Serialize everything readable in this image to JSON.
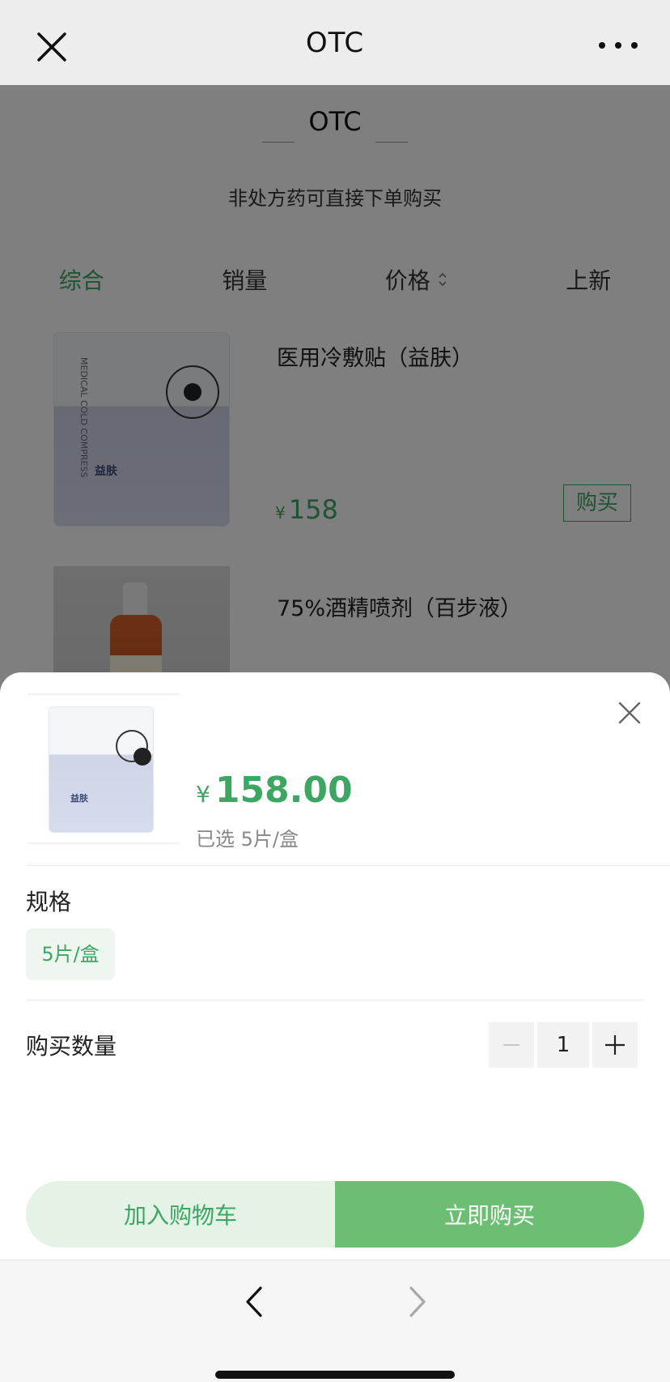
{
  "navbar": {
    "title": "OTC",
    "close_icon": "close-icon",
    "more_icon": "more-icon"
  },
  "section": {
    "title": "OTC",
    "subtitle": "非处方药可直接下单购买"
  },
  "sort": {
    "items": [
      {
        "label": "综合",
        "active": true
      },
      {
        "label": "销量"
      },
      {
        "label": "价格",
        "icon": "sort-arrows-icon"
      },
      {
        "label": "上新"
      }
    ]
  },
  "products": [
    {
      "name": "医用冷敷贴（益肤）",
      "currency": "¥",
      "price": "158",
      "buy_label": "购买",
      "thumb_brand": "益肤"
    },
    {
      "name": "75%酒精喷剂（百步液）"
    }
  ],
  "sheet": {
    "currency": "¥",
    "price": "158.00",
    "selected": "已选 5片/盒",
    "spec_label": "规格",
    "spec_option": "5片/盒",
    "qty_label": "购买数量",
    "qty_value": "1",
    "add_cart_label": "加入购物车",
    "buy_now_label": "立即购买"
  },
  "colors": {
    "accent": "#3ea663",
    "accent_button": "#6cbf72",
    "accent_light": "#e5f3e7"
  }
}
